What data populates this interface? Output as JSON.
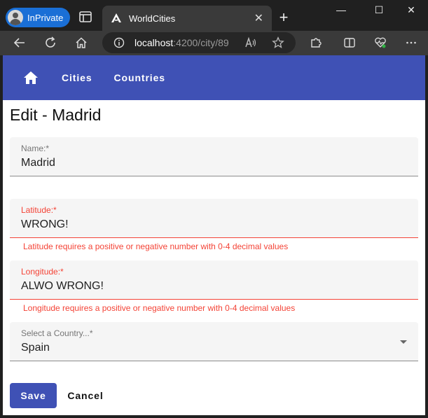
{
  "browser": {
    "profile_label": "InPrivate",
    "tab_title": "WorldCities",
    "tab_close": "✕",
    "new_tab": "+",
    "url_host": "localhost",
    "url_path": ":4200/city/89",
    "window_controls": [
      "—",
      "☐",
      "✕"
    ]
  },
  "navbar": {
    "links": [
      "Cities",
      "Countries"
    ],
    "home_icon": "home-icon",
    "color": "#3f51b5"
  },
  "form": {
    "title": "Edit - Madrid",
    "name": {
      "label": "Name:*",
      "value": "Madrid"
    },
    "latitude": {
      "label": "Latitude:*",
      "value": "WRONG!",
      "error": "Latitude requires a positive or negative number with 0-4 decimal values"
    },
    "longitude": {
      "label": "Longitude:*",
      "value": "ALWO WRONG!",
      "error": "Longitude requires a positive or negative number with 0-4 decimal values"
    },
    "country": {
      "label": "Select a Country...*",
      "value": "Spain"
    },
    "error_color": "#f44336",
    "save_label": "Save",
    "cancel_label": "Cancel"
  }
}
